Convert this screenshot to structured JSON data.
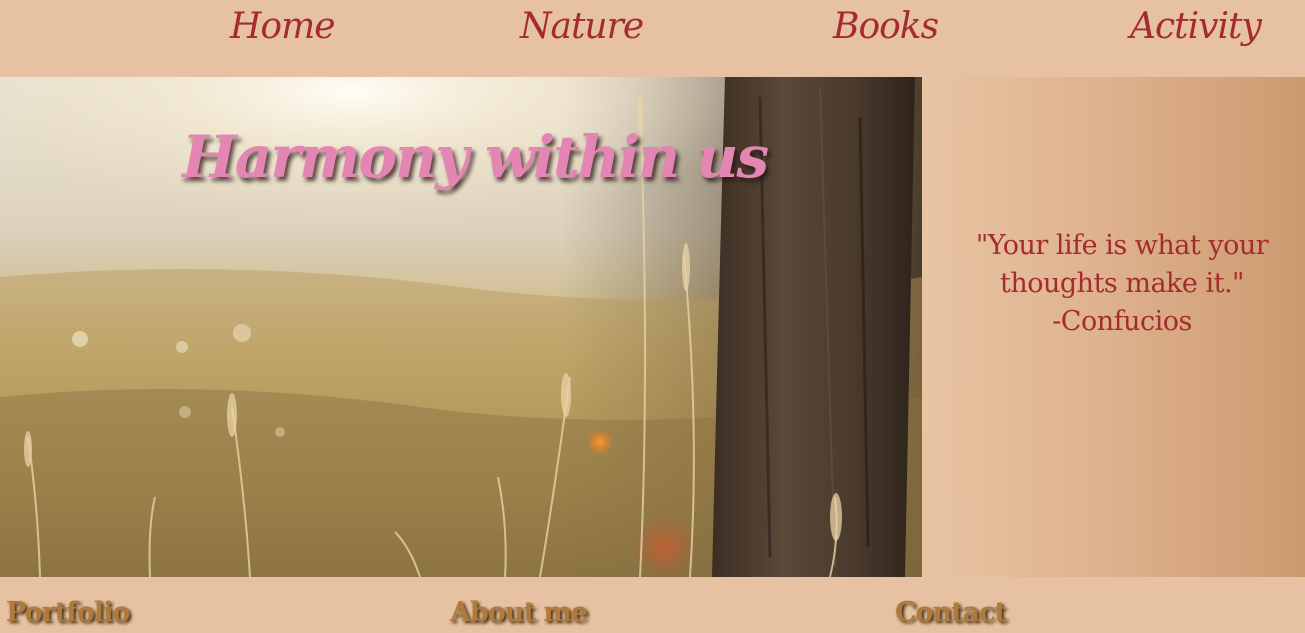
{
  "nav": {
    "home": "Home",
    "nature": "Nature",
    "books": "Books",
    "activity": "Activity"
  },
  "hero": {
    "title": "Harmony within us",
    "image": "sunlit-meadow-with-tree-trunk"
  },
  "quote": {
    "line1": "\"Your life is what your",
    "line2": "thoughts make it.\"",
    "author": "-Confucios"
  },
  "footer": {
    "portfolio": "Portfolio",
    "about": "About me",
    "contact": "Contact"
  },
  "colors": {
    "background": "#e6c2a2",
    "nav_text": "#a52b2e",
    "hero_title": "#e486b4",
    "footer_text": "#b07a3a"
  }
}
